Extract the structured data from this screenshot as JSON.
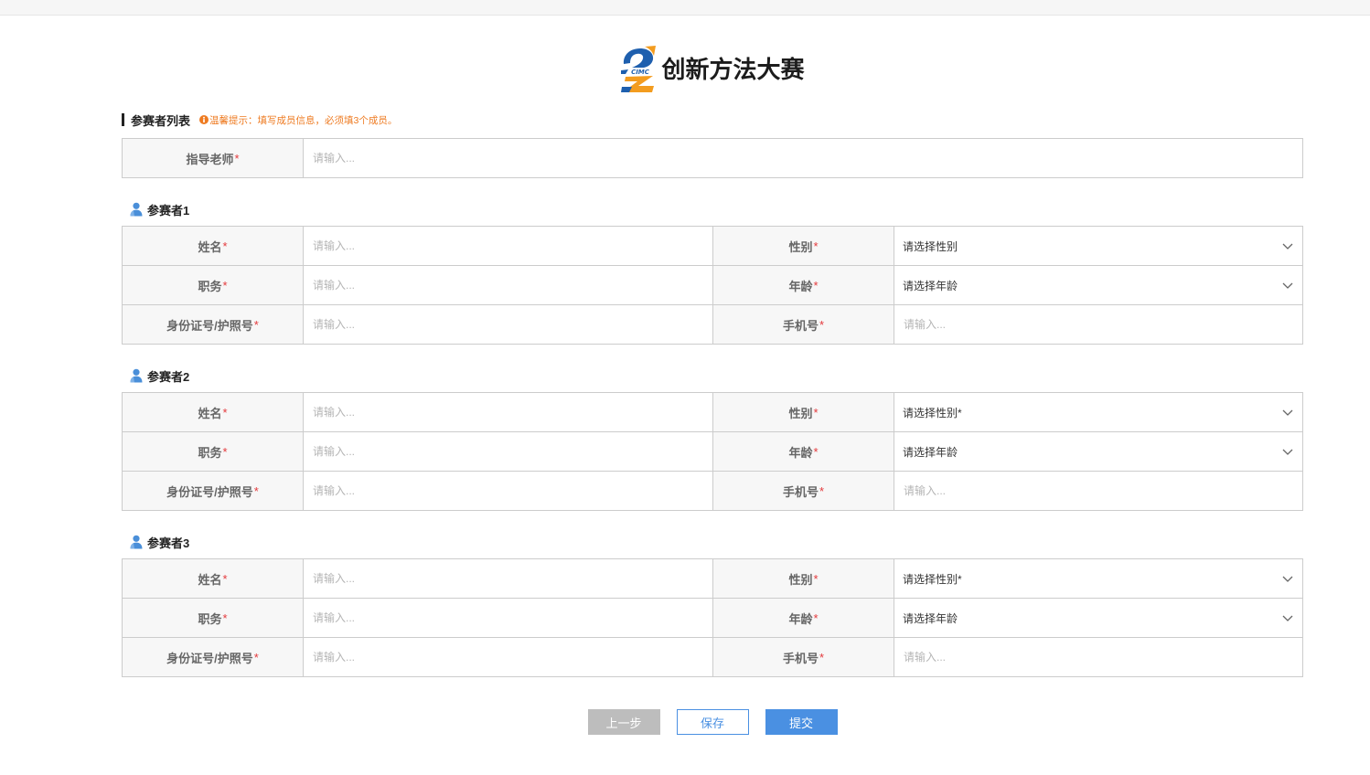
{
  "brand": {
    "logo_text": "CIMC",
    "title": "创新方法大赛"
  },
  "section": {
    "title": "参赛者列表",
    "hint": "温馨提示：填写成员信息，必须填3个成员。",
    "hint_icon": "info-circle-icon"
  },
  "form": {
    "required_mark": "*",
    "participant_icon": "user-icon",
    "select_icon": "chevron-down-icon"
  },
  "advisor": {
    "label": "指导老师",
    "placeholder": "请输入..."
  },
  "participants": [
    {
      "title": "参赛者1",
      "name": {
        "label": "姓名",
        "placeholder": "请输入..."
      },
      "gender": {
        "label": "性别",
        "value": "请选择性别"
      },
      "position": {
        "label": "职务",
        "placeholder": "请输入..."
      },
      "age": {
        "label": "年龄",
        "value": "请选择年龄"
      },
      "id_number": {
        "label": "身份证号/护照号",
        "placeholder": "请输入..."
      },
      "phone": {
        "label": "手机号",
        "placeholder": "请输入..."
      }
    },
    {
      "title": "参赛者2",
      "name": {
        "label": "姓名",
        "placeholder": "请输入..."
      },
      "gender": {
        "label": "性别",
        "value": "请选择性别*"
      },
      "position": {
        "label": "职务",
        "placeholder": "请输入..."
      },
      "age": {
        "label": "年龄",
        "value": "请选择年龄"
      },
      "id_number": {
        "label": "身份证号/护照号",
        "placeholder": "请输入..."
      },
      "phone": {
        "label": "手机号",
        "placeholder": "请输入..."
      }
    },
    {
      "title": "参赛者3",
      "name": {
        "label": "姓名",
        "placeholder": "请输入..."
      },
      "gender": {
        "label": "性别",
        "value": "请选择性别*"
      },
      "position": {
        "label": "职务",
        "placeholder": "请输入..."
      },
      "age": {
        "label": "年龄",
        "value": "请选择年龄"
      },
      "id_number": {
        "label": "身份证号/护照号",
        "placeholder": "请输入..."
      },
      "phone": {
        "label": "手机号",
        "placeholder": "请输入..."
      }
    }
  ],
  "buttons": {
    "prev": "上一步",
    "save": "保存",
    "submit": "提交"
  },
  "colors": {
    "accent": "#4a90e2",
    "hint": "#ee7b22",
    "required": "#e4393c",
    "label_background": "#f7f7f7",
    "border": "#cccccc",
    "button_disabled": "#bdbdbd",
    "logo_blue": "#1e5fae",
    "logo_orange": "#f39c1f"
  }
}
